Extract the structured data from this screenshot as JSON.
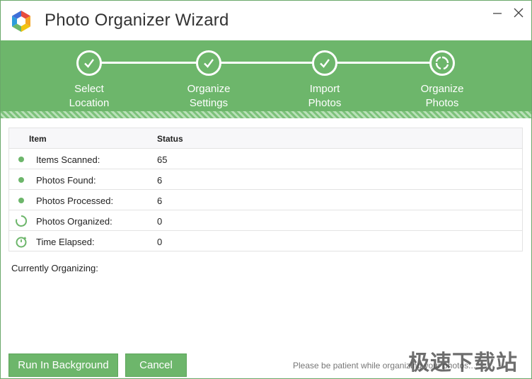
{
  "window": {
    "title": "Photo Organizer Wizard",
    "minimize_icon": "minimize-icon",
    "close_icon": "close-icon"
  },
  "steps": [
    {
      "line1": "Select",
      "line2": "Location",
      "state": "done",
      "icon": "check-icon"
    },
    {
      "line1": "Organize",
      "line2": "Settings",
      "state": "done",
      "icon": "check-icon"
    },
    {
      "line1": "Import",
      "line2": "Photos",
      "state": "done",
      "icon": "check-icon"
    },
    {
      "line1": "Organize",
      "line2": "Photos",
      "state": "in-progress",
      "icon": "spinner-icon"
    }
  ],
  "table": {
    "headers": {
      "item": "Item",
      "status": "Status"
    },
    "rows": [
      {
        "label": "Items Scanned:",
        "value": "65",
        "icon": "dot-icon"
      },
      {
        "label": "Photos Found:",
        "value": "6",
        "icon": "dot-icon"
      },
      {
        "label": "Photos Processed:",
        "value": "6",
        "icon": "dot-icon"
      },
      {
        "label": "Photos Organized:",
        "value": "0",
        "icon": "loading-icon"
      },
      {
        "label": "Time Elapsed:",
        "value": "0",
        "icon": "stopwatch-icon"
      }
    ]
  },
  "currently_organizing_label": "Currently Organizing:",
  "buttons": {
    "run_in_background": "Run In Background",
    "cancel": "Cancel"
  },
  "footer_note": "Please be patient while organizing your photos...",
  "watermark": "极速下载站",
  "colors": {
    "accent": "#6db66b",
    "text": "#222222"
  }
}
